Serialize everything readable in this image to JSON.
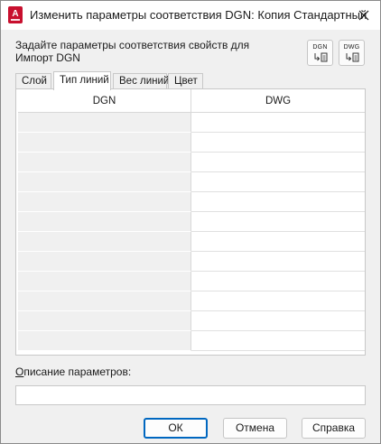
{
  "window": {
    "title": "Изменить параметры соответствия DGN:  Копия Стандартный"
  },
  "instruction": {
    "line1": "Задайте параметры соответствия свойств для",
    "line2": "Импорт DGN"
  },
  "mapping_buttons": {
    "dgn_label": "DGN",
    "dwg_label": "DWG"
  },
  "tabs": [
    {
      "label": "Слой"
    },
    {
      "label": "Тип линий"
    },
    {
      "label": "Вес линий"
    },
    {
      "label": "Цвет"
    }
  ],
  "active_tab": "Тип линий",
  "grid": {
    "columns": [
      "DGN",
      "DWG"
    ],
    "row_count": 12
  },
  "description": {
    "label_underlined": "О",
    "label_rest": "писание параметров:",
    "value": ""
  },
  "buttons": {
    "ok": "ОК",
    "cancel": "Отмена",
    "help": "Справка"
  },
  "colors": {
    "accent": "#0067c0",
    "app_icon": "#c8102e"
  },
  "icons": {
    "app": "autocad-app-icon",
    "close": "close-icon",
    "map_to_file": "map-arrow-file-icon"
  }
}
